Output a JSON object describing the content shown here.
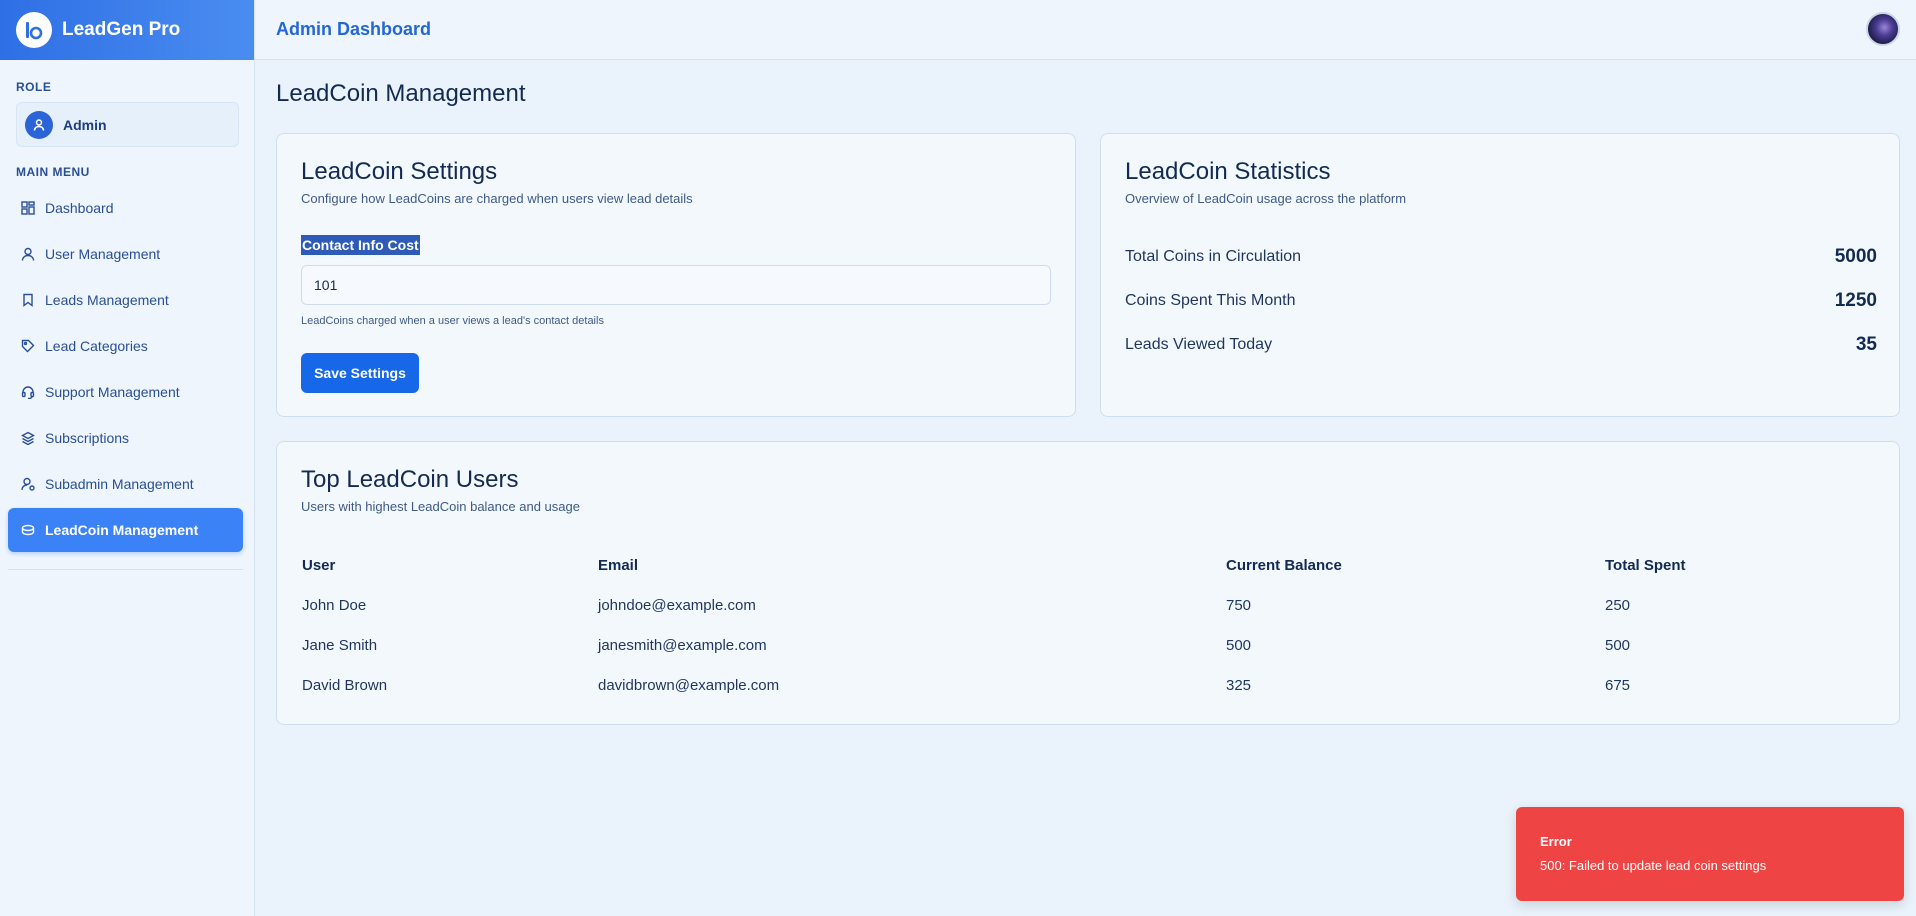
{
  "app": {
    "name": "LeadGen Pro"
  },
  "sidebar": {
    "role_label": "ROLE",
    "role": "Admin",
    "menu_label": "MAIN MENU",
    "items": [
      {
        "label": "Dashboard",
        "icon": "grid-icon"
      },
      {
        "label": "User Management",
        "icon": "user-icon"
      },
      {
        "label": "Leads Management",
        "icon": "bookmark-icon"
      },
      {
        "label": "Lead Categories",
        "icon": "tag-icon"
      },
      {
        "label": "Support Management",
        "icon": "headset-icon"
      },
      {
        "label": "Subscriptions",
        "icon": "layers-icon"
      },
      {
        "label": "Subadmin Management",
        "icon": "user-cog-icon"
      },
      {
        "label": "LeadCoin Management",
        "icon": "coin-icon",
        "active": true
      }
    ]
  },
  "header": {
    "title": "Admin Dashboard"
  },
  "main": {
    "page_title": "LeadCoin Management",
    "settings": {
      "title": "LeadCoin Settings",
      "subtitle": "Configure how LeadCoins are charged when users view lead details",
      "field_label": "Contact Info Cost",
      "field_value": "101",
      "field_help": "LeadCoins charged when a user views a lead's contact details",
      "save_label": "Save Settings"
    },
    "stats": {
      "title": "LeadCoin Statistics",
      "subtitle": "Overview of LeadCoin usage across the platform",
      "rows": [
        {
          "label": "Total Coins in Circulation",
          "value": "5000"
        },
        {
          "label": "Coins Spent This Month",
          "value": "1250"
        },
        {
          "label": "Leads Viewed Today",
          "value": "35"
        }
      ]
    },
    "top_users": {
      "title": "Top LeadCoin Users",
      "subtitle": "Users with highest LeadCoin balance and usage",
      "columns": [
        "User",
        "Email",
        "Current Balance",
        "Total Spent"
      ],
      "rows": [
        [
          "John Doe",
          "johndoe@example.com",
          "750",
          "250"
        ],
        [
          "Jane Smith",
          "janesmith@example.com",
          "500",
          "500"
        ],
        [
          "David Brown",
          "davidbrown@example.com",
          "325",
          "675"
        ]
      ]
    }
  },
  "toast": {
    "title": "Error",
    "message": "500: Failed to update lead coin settings"
  },
  "colors": {
    "brand": "#3b82f6",
    "primary_button": "#1668e8",
    "error": "#ef4444"
  }
}
